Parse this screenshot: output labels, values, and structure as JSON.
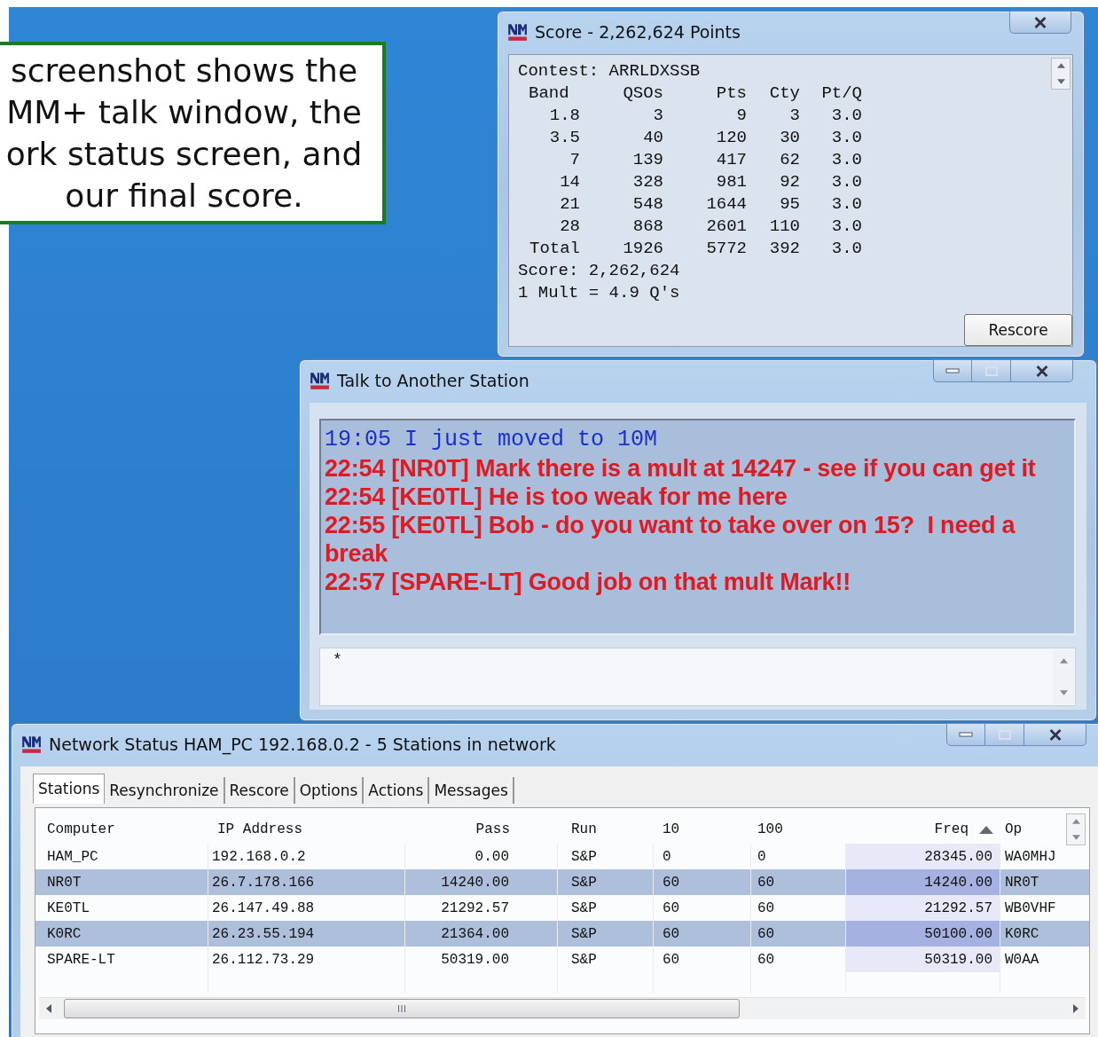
{
  "callout": {
    "lines": [
      "screenshot shows the",
      "MM+ talk window, the",
      "ork status screen, and",
      "our final score."
    ]
  },
  "score_window": {
    "title": "Score - 2,262,624 Points",
    "contest": "Contest: ARRLDXSSB",
    "columns": [
      "Band",
      "QSOs",
      "Pts",
      "Cty",
      "Pt/Q"
    ],
    "rows": [
      [
        "1.8",
        "3",
        "9",
        "3",
        "3.0"
      ],
      [
        "3.5",
        "40",
        "120",
        "30",
        "3.0"
      ],
      [
        "7",
        "139",
        "417",
        "62",
        "3.0"
      ],
      [
        "14",
        "328",
        "981",
        "92",
        "3.0"
      ],
      [
        "21",
        "548",
        "1644",
        "95",
        "3.0"
      ],
      [
        "28",
        "868",
        "2601",
        "110",
        "3.0"
      ],
      [
        "Total",
        "1926",
        "5772",
        "392",
        "3.0"
      ]
    ],
    "score": "Score: 2,262,624",
    "mult": "1 Mult = 4.9 Q's",
    "button": "Rescore"
  },
  "talk_window": {
    "title": "Talk to Another Station",
    "messages": [
      {
        "kind": "local",
        "text": "19:05 I just moved to 10M"
      },
      {
        "kind": "remote",
        "text": "22:54 [NR0T] Mark there is a mult at 14247 - see if you can get it"
      },
      {
        "kind": "remote",
        "text": "22:54 [KE0TL] He is too weak for me here"
      },
      {
        "kind": "remote",
        "text": "22:55 [KE0TL] Bob - do you want to take over on 15?  I need a break"
      },
      {
        "kind": "remote",
        "text": "22:57 [SPARE-LT] Good job on that mult Mark!!"
      }
    ],
    "input_value": "*"
  },
  "network_window": {
    "title": "Network Status HAM_PC 192.168.0.2 - 5 Stations in network",
    "tabs": [
      {
        "label": "Stations",
        "selected": true
      },
      {
        "label": "Resynchronize",
        "selected": false
      },
      {
        "label": "Rescore",
        "selected": false
      },
      {
        "label": "Options",
        "selected": false
      },
      {
        "label": "Actions",
        "selected": false
      },
      {
        "label": "Messages",
        "selected": false
      }
    ],
    "columns": [
      {
        "label": "Computer",
        "sorted": false
      },
      {
        "label": "IP Address",
        "sorted": false
      },
      {
        "label": "Pass",
        "sorted": false
      },
      {
        "label": "Run",
        "sorted": false
      },
      {
        "label": "10",
        "sorted": false
      },
      {
        "label": "100",
        "sorted": false
      },
      {
        "label": "Freq",
        "sorted": true
      },
      {
        "label": "Op",
        "sorted": false
      }
    ],
    "rows": [
      {
        "selected": false,
        "cells": [
          "HAM_PC",
          "192.168.0.2",
          "0.00",
          "S&P",
          "0",
          "0",
          "28345.00",
          "WA0MHJ"
        ]
      },
      {
        "selected": true,
        "cells": [
          "NR0T",
          "26.7.178.166",
          "14240.00",
          "S&P",
          "60",
          "60",
          "14240.00",
          "NR0T"
        ]
      },
      {
        "selected": false,
        "cells": [
          "KE0TL",
          "26.147.49.88",
          "21292.57",
          "S&P",
          "60",
          "60",
          "21292.57",
          "WB0VHF"
        ]
      },
      {
        "selected": true,
        "cells": [
          "K0RC",
          "26.23.55.194",
          "21364.00",
          "S&P",
          "60",
          "60",
          "50100.00",
          "K0RC"
        ]
      },
      {
        "selected": false,
        "cells": [
          "SPARE-LT",
          "26.112.73.29",
          "50319.00",
          "S&P",
          "60",
          "60",
          "50319.00",
          "W0AA"
        ]
      }
    ]
  }
}
